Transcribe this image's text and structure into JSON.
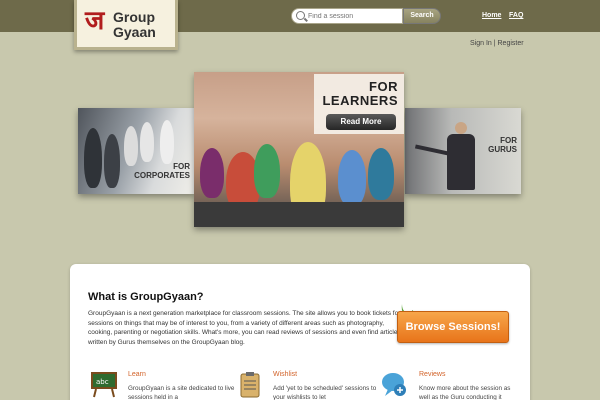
{
  "header": {
    "logo_line1": "Group",
    "logo_line2": "Gyaan",
    "search_placeholder": "Find a session",
    "search_button": "Search",
    "nav": [
      "Home",
      "FAQ"
    ],
    "account_links": "Sign In | Register"
  },
  "hero": {
    "corporates_label_1": "FOR",
    "corporates_label_2": "CORPORATES",
    "learners_label_1": "FOR",
    "learners_label_2": "LEARNERS",
    "read_more": "Read More",
    "gurus_label_1": "FOR",
    "gurus_label_2": "GURUS"
  },
  "about": {
    "title": "What is GroupGyaan?",
    "body": "GroupGyaan is a next generation marketplace for classroom sessions. The site allows you to book tickets for sessions on things that may be of interest to you, from a variety of different areas such as photography, cooking, parenting or negotiation skills. What's more, you can read reviews of sessions and even find articles written by Gurus themselves on the GroupGyaan blog.",
    "browse_button": "Browse Sessions!"
  },
  "features": [
    {
      "title": "Learn",
      "text": "GroupGyaan is a site dedicated to live sessions held in a",
      "icon": "chalkboard-icon"
    },
    {
      "title": "Wishlist",
      "text": "Add 'yet to be scheduled' sessions to your wishlists to let",
      "icon": "clipboard-icon"
    },
    {
      "title": "Reviews",
      "text": "Know more about the session as well as the Guru conducting it",
      "icon": "speech-bubble-icon"
    }
  ],
  "colors": {
    "background": "#c8c8ad",
    "topbar": "#6e6a4a",
    "accent_orange": "#e8741a",
    "feature_title": "#d2632a"
  }
}
